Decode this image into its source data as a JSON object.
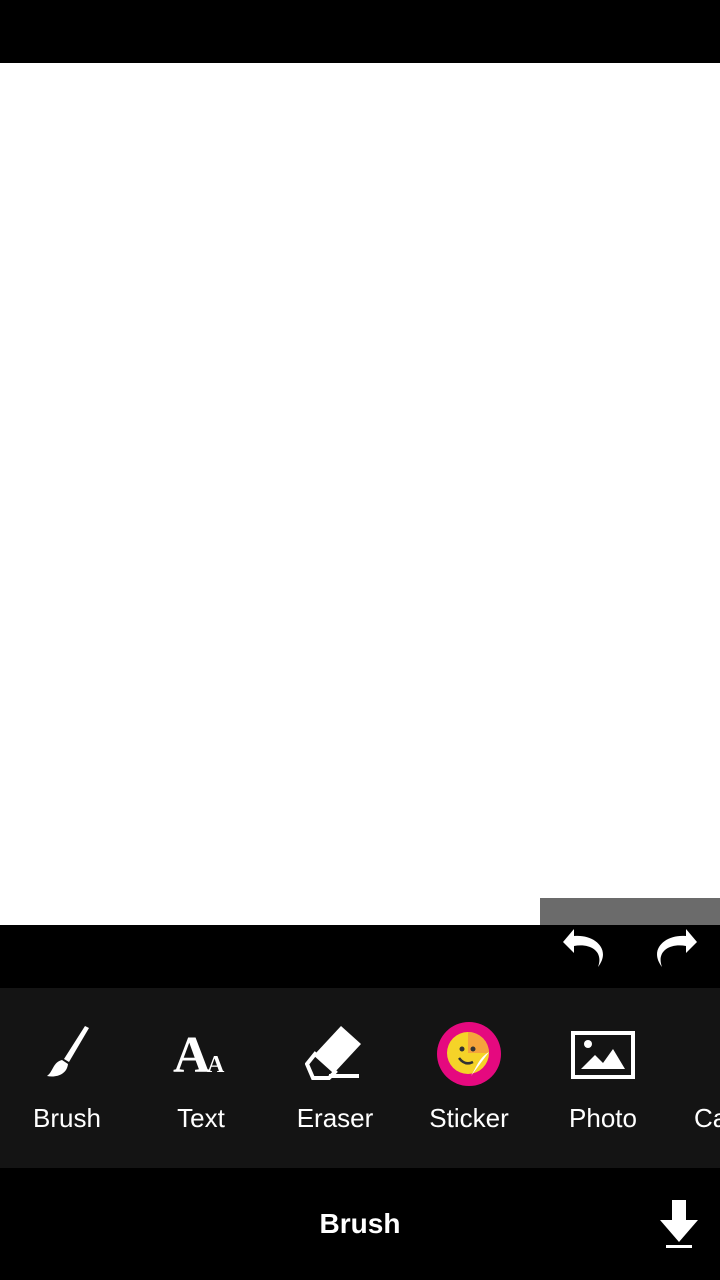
{
  "canvas": {
    "background": "#ffffff"
  },
  "history": {
    "undo_icon": "undo-icon",
    "redo_icon": "redo-icon"
  },
  "tools": [
    {
      "label": "Brush",
      "icon": "brush-icon"
    },
    {
      "label": "Text",
      "icon": "text-icon"
    },
    {
      "label": "Eraser",
      "icon": "eraser-icon"
    },
    {
      "label": "Sticker",
      "icon": "sticker-icon"
    },
    {
      "label": "Photo",
      "icon": "photo-icon"
    },
    {
      "label": "Ca",
      "icon": "camera-icon"
    }
  ],
  "bottom": {
    "title": "Brush",
    "download_icon": "download-icon"
  },
  "colors": {
    "sticker_accent": "#e5097f",
    "sticker_face": "#f5d328"
  }
}
